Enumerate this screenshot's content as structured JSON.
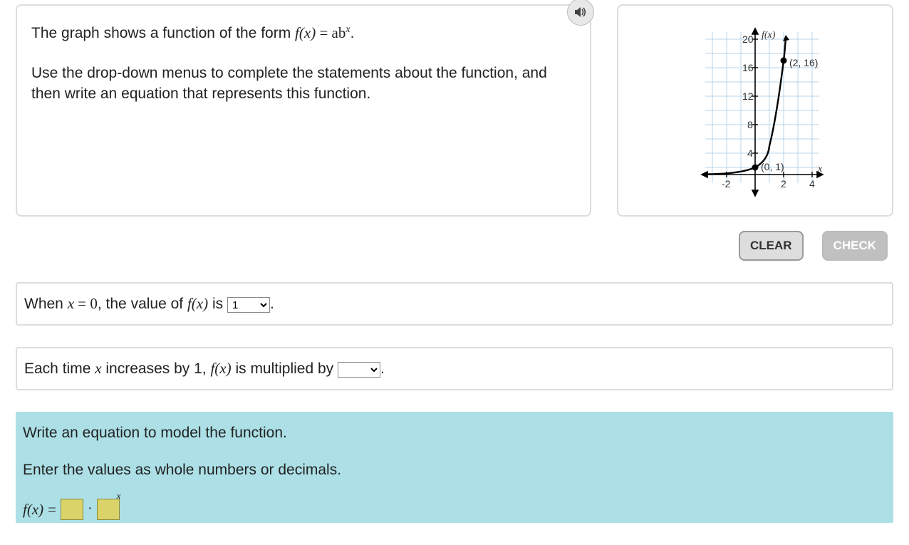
{
  "question": {
    "line1_a": "The graph shows a function of the form ",
    "line1_fx": "f(x)",
    "line1_eq": " = ab",
    "line1_sup": "x",
    "line1_end": ".",
    "line2": "Use the drop-down menus to complete the statements about the function, and then write an equation that represents this function."
  },
  "chart_data": {
    "type": "line",
    "function": "exponential",
    "axis_label_y": "f(x)",
    "axis_label_x": "x",
    "x_ticks": [
      -2,
      2,
      4
    ],
    "y_ticks": [
      4,
      8,
      12,
      16,
      20
    ],
    "xlim": [
      -3,
      5
    ],
    "ylim": [
      -2,
      21
    ],
    "labeled_points": [
      {
        "x": 0,
        "y": 1,
        "label": "(0, 1)"
      },
      {
        "x": 2,
        "y": 16,
        "label": "(2, 16)"
      }
    ],
    "series": [
      {
        "name": "f(x)",
        "points": [
          [
            -2.5,
            0.06
          ],
          [
            -2,
            0.0625
          ],
          [
            -1,
            0.25
          ],
          [
            0,
            1
          ],
          [
            0.5,
            2
          ],
          [
            1,
            4
          ],
          [
            1.5,
            8
          ],
          [
            2,
            16
          ],
          [
            2.15,
            20
          ]
        ]
      }
    ],
    "grid": true
  },
  "buttons": {
    "clear": "CLEAR",
    "check": "CHECK"
  },
  "statement1": {
    "pre_a": "When ",
    "var_x": "x",
    "eq0": " = 0",
    "mid": ", the value of ",
    "fx": "f(x)",
    "post": " is ",
    "selected": "1",
    "period": "."
  },
  "statement2": {
    "pre_a": "Each time ",
    "var_x": "x",
    "mid1": " increases by 1, ",
    "fx": "f(x)",
    "mid2": " is multiplied by ",
    "selected": "",
    "period": "."
  },
  "equation": {
    "heading": "Write an equation to model the function.",
    "instruction": "Enter the values as whole numbers or decimals.",
    "fx": "f(x)",
    "eq": " = ",
    "sup": "x"
  }
}
